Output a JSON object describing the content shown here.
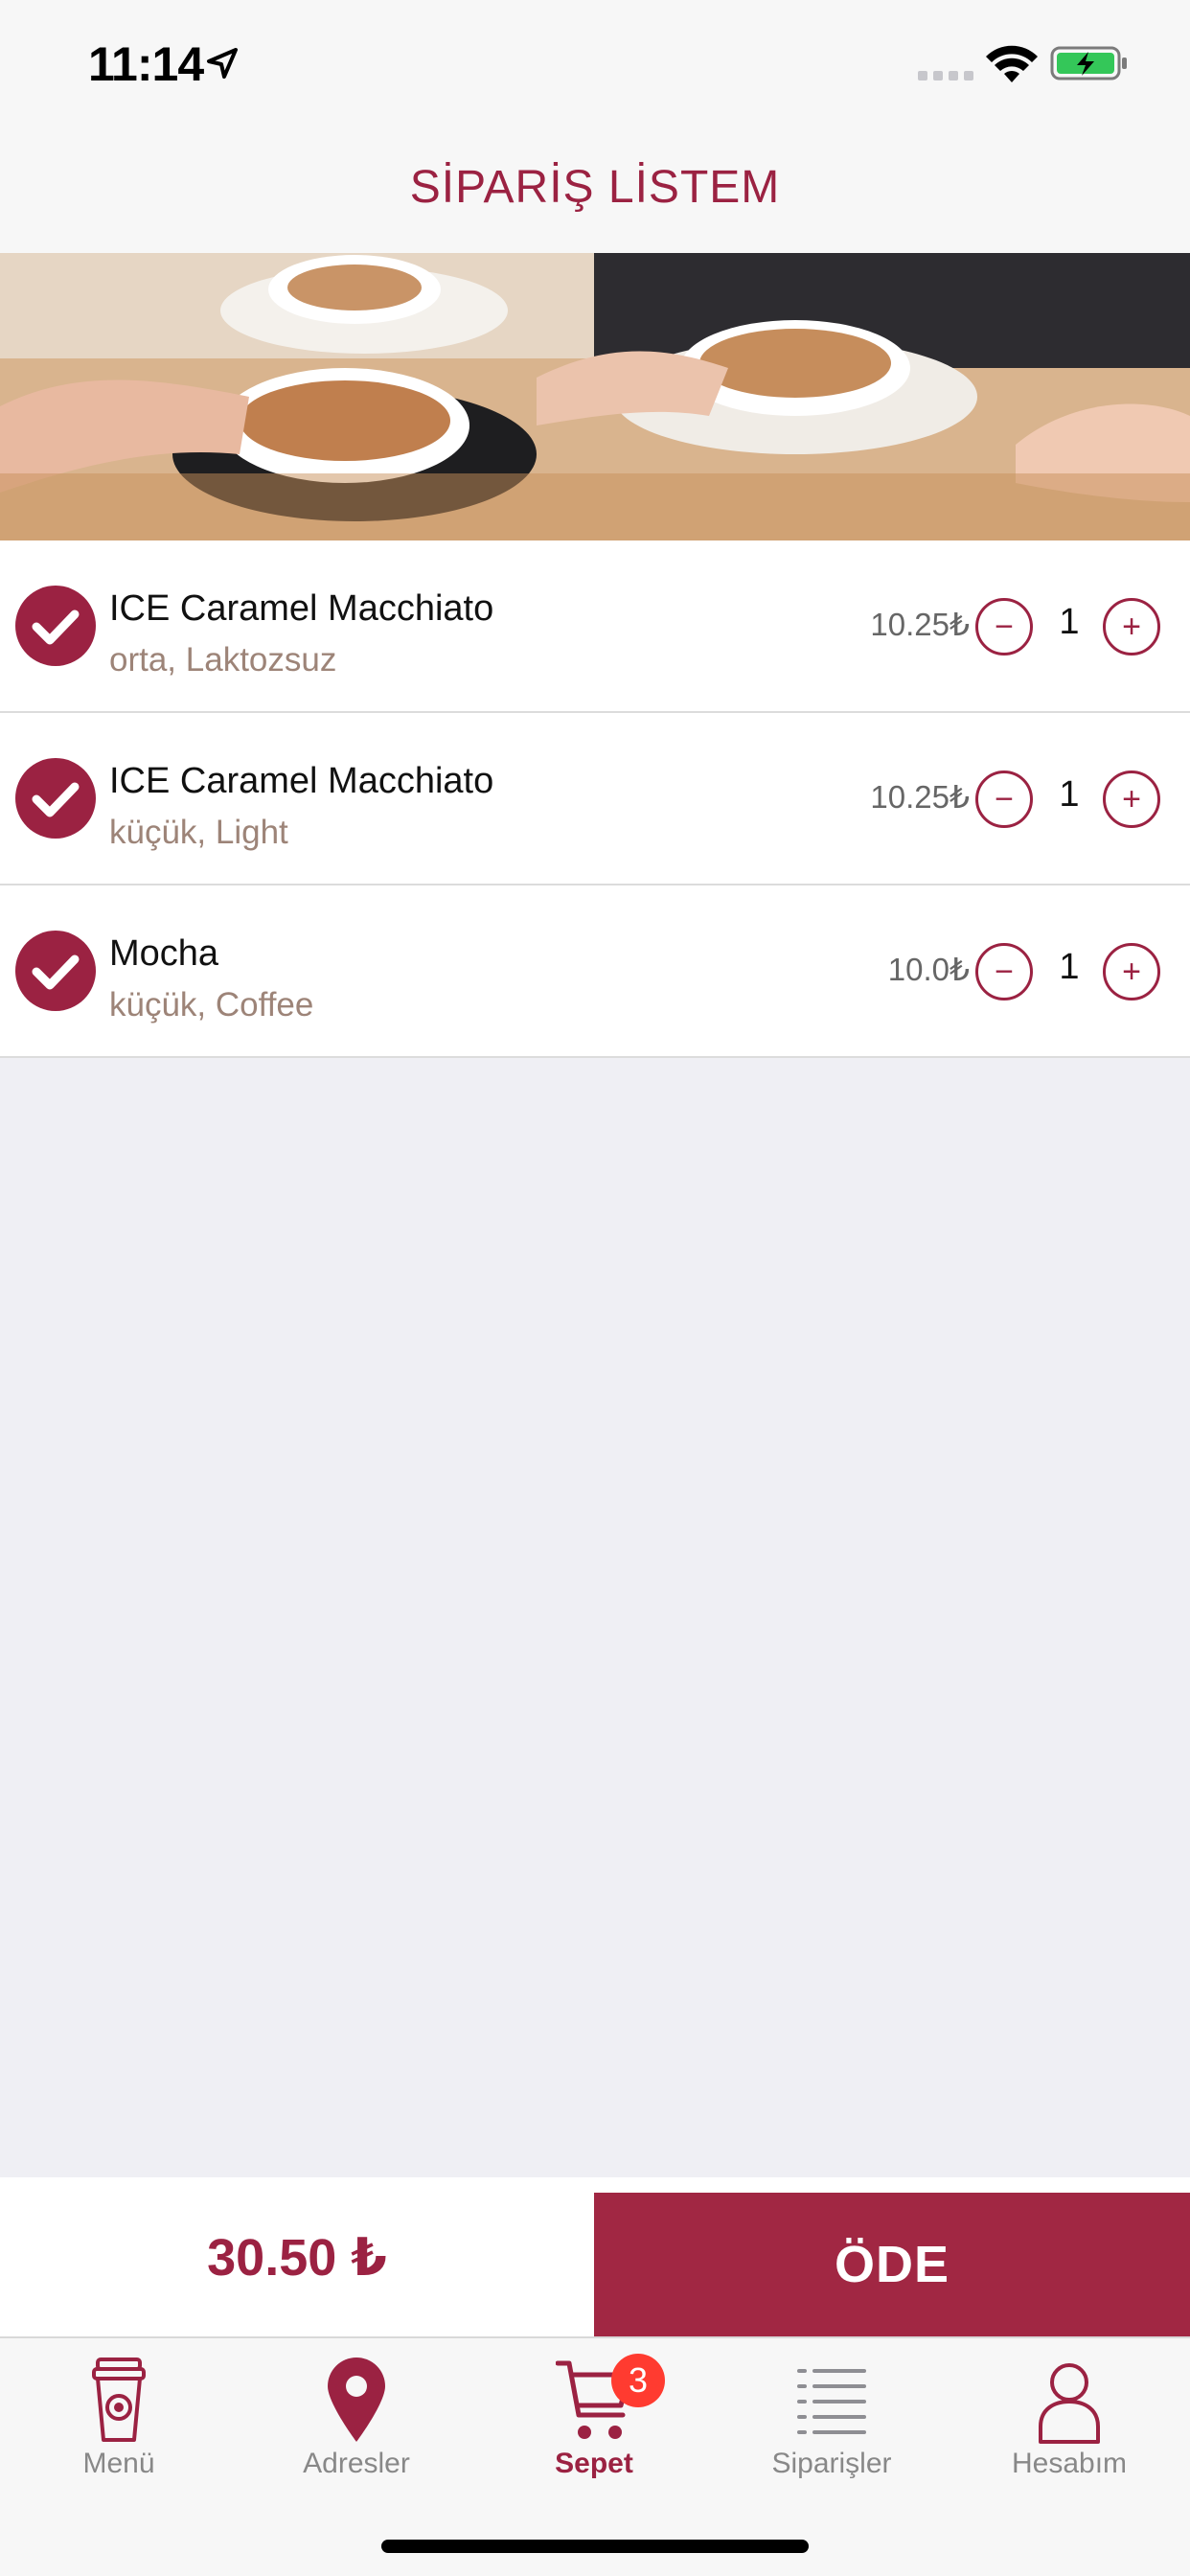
{
  "status_bar": {
    "time": "11:14",
    "icons": [
      "location-arrow-icon",
      "cell-signal-icon",
      "wifi-icon",
      "battery-charging-icon"
    ]
  },
  "header": {
    "title": "SİPARİŞ LİSTEM"
  },
  "banner": {
    "icon": "coffee-cups-photo"
  },
  "order_items": [
    {
      "name": "ICE Caramel Macchiato",
      "options": "orta, Laktozsuz",
      "price": "10.25₺",
      "quantity": "1"
    },
    {
      "name": "ICE Caramel Macchiato",
      "options": "küçük, Light",
      "price": "10.25₺",
      "quantity": "1"
    },
    {
      "name": "Mocha",
      "options": "küçük, Coffee",
      "price": "10.0₺",
      "quantity": "1"
    }
  ],
  "qty_controls": {
    "minus": "−",
    "plus": "+"
  },
  "checkout": {
    "total": "30.50 ₺",
    "pay_label": "ÖDE"
  },
  "tab_bar": {
    "tabs": [
      {
        "label": "Menü",
        "icon": "coffee-cup-icon"
      },
      {
        "label": "Adresler",
        "icon": "map-pin-icon"
      },
      {
        "label": "Sepet",
        "icon": "cart-icon",
        "badge": "3",
        "active": true
      },
      {
        "label": "Siparişler",
        "icon": "list-icon"
      },
      {
        "label": "Hesabım",
        "icon": "user-icon"
      }
    ]
  },
  "colors": {
    "brand": "#9b2242",
    "pay_button": "#a12743",
    "background": "#efeff4",
    "badge": "#ff3b30",
    "options_text": "#9d8478"
  }
}
